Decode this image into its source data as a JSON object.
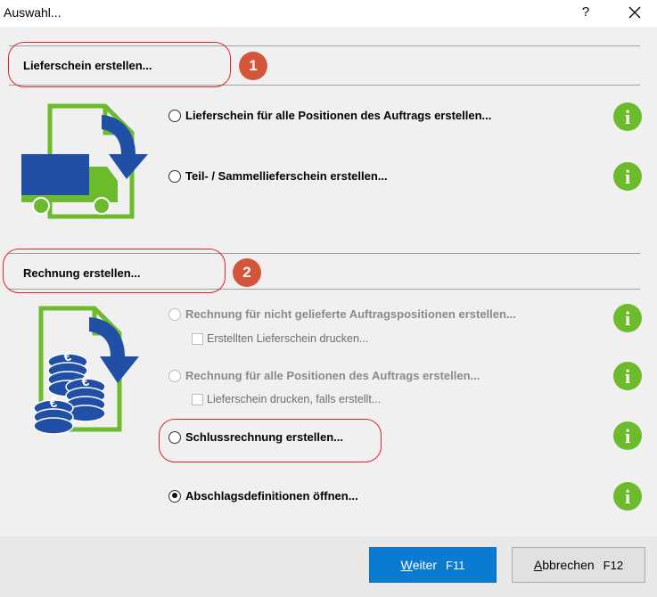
{
  "window": {
    "title": "Auswahl...",
    "help_label": "?"
  },
  "sections": {
    "delivery": {
      "title": "Lieferschein erstellen...",
      "badge": "1",
      "options": [
        "Lieferschein für alle Positionen des Auftrags erstellen...",
        "Teil- / Sammellieferschein erstellen..."
      ]
    },
    "invoice": {
      "title": "Rechnung erstellen...",
      "badge": "2",
      "options": [
        "Rechnung für nicht gelieferte Auftragspositionen erstellen...",
        "Rechnung für alle Positionen des Auftrags erstellen...",
        "Schlussrechnung erstellen...",
        "Abschlagsdefinitionen öffnen..."
      ],
      "checkboxes": [
        "Erstellten Lieferschein drucken...",
        "Lieferschein drucken, falls erstellt..."
      ]
    }
  },
  "info_icon_letter": "i",
  "euro_symbol": "€",
  "buttons": {
    "next": {
      "accel": "W",
      "rest": "eiter",
      "key": "F11"
    },
    "cancel": {
      "accel": "A",
      "rest": "bbrechen",
      "key": "F12"
    }
  },
  "colors": {
    "accent_blue": "#0b7ad1",
    "info_green": "#6cbb2c",
    "badge_orange": "#d4563a",
    "highlight_red": "#d9232d",
    "truck_blue": "#214fa6",
    "doc_green": "#6cbb2c"
  }
}
